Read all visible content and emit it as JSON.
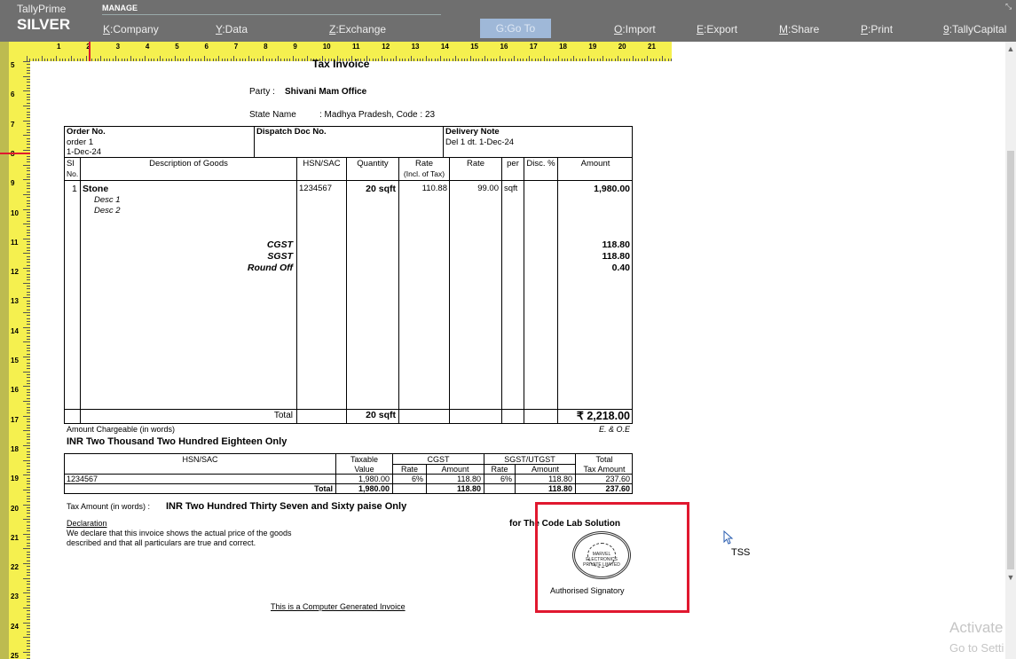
{
  "topbar": {
    "brand_top": "TallyPrime",
    "brand_edition": "SILVER",
    "manage_label": "MANAGE",
    "menu": [
      {
        "key": "K",
        "label": ":Company"
      },
      {
        "key": "Y",
        "label": ":Data"
      },
      {
        "key": "Z",
        "label": ":Exchange"
      },
      {
        "key": "G",
        "label": ":Go To"
      },
      {
        "key": "O",
        "label": ":Import"
      },
      {
        "key": "E",
        "label": ":Export"
      },
      {
        "key": "M",
        "label": ":Share"
      },
      {
        "key": "P",
        "label": ":Print"
      },
      {
        "key": "9",
        "label": ":TallyCapital"
      }
    ]
  },
  "ruler": {
    "h_numbers": [
      "1",
      "2",
      "3",
      "4",
      "5",
      "6",
      "7",
      "8",
      "9",
      "10",
      "11",
      "12",
      "13",
      "14",
      "15",
      "16",
      "17",
      "18",
      "19",
      "20",
      "21"
    ],
    "v_numbers": [
      "5",
      "6",
      "7",
      "8",
      "9",
      "10",
      "11",
      "12",
      "13",
      "14",
      "15",
      "16",
      "17",
      "18",
      "19",
      "20",
      "21",
      "22",
      "23",
      "24",
      "25"
    ]
  },
  "invoice": {
    "title": "Tax Invoice",
    "party_label": "Party :",
    "party_name": "Shivani Mam Office",
    "state_label": "State Name",
    "state_value": ": Madhya Pradesh, Code : 23",
    "order_no_label": "Order No.",
    "order_no": "order 1",
    "order_date": "1-Dec-24",
    "dispatch_label": "Dispatch Doc No.",
    "delivery_label": "Delivery Note",
    "delivery_value": "Del 1 dt. 1-Dec-24",
    "col_sl": "Sl",
    "col_no": "No.",
    "col_desc": "Description of Goods",
    "col_hsn": "HSN/SAC",
    "col_qty": "Quantity",
    "col_rate_incl": "Rate",
    "col_rate_incl2": "(Incl. of Tax)",
    "col_rate": "Rate",
    "col_per": "per",
    "col_disc": "Disc. %",
    "col_amount": "Amount",
    "item_sl": "1",
    "item_name": "Stone",
    "item_desc1": "Desc 1",
    "item_desc2": "Desc 2",
    "item_hsn": "1234567",
    "item_qty": "20 sqft",
    "item_rate_incl": "110.88",
    "item_rate": "99.00",
    "item_per": "sqft",
    "item_amount": "1,980.00",
    "cgst_label": "CGST",
    "sgst_label": "SGST",
    "roundoff_label": "Round Off",
    "cgst_amount": "118.80",
    "sgst_amount": "118.80",
    "roundoff_amount": "0.40",
    "total_label": "Total",
    "total_qty": "20 sqft",
    "total_amount": "₹ 2,218.00",
    "amount_words_label": "Amount Chargeable (in words)",
    "eoe": "E. & O.E",
    "amount_words": "INR Two Thousand Two Hundred Eighteen Only",
    "tax": {
      "h_hsn": "HSN/SAC",
      "h_taxable": "Taxable",
      "h_value": "Value",
      "h_cgst": "CGST",
      "h_sgst": "SGST/UTGST",
      "h_total": "Total",
      "h_rate": "Rate",
      "h_amount": "Amount",
      "h_tax_amount": "Tax Amount",
      "row_hsn": "1234567",
      "row_taxable": "1,980.00",
      "row_cgst_rate": "6%",
      "row_cgst_amt": "118.80",
      "row_sgst_rate": "6%",
      "row_sgst_amt": "118.80",
      "row_total": "237.60",
      "total_label": "Total",
      "total_taxable": "1,980.00",
      "total_cgst": "118.80",
      "total_sgst": "118.80",
      "total_total": "237.60"
    },
    "tax_words_label": "Tax Amount (in words) :",
    "tax_words": "INR Two Hundred Thirty Seven and Sixty paise Only",
    "declaration_title": "Declaration",
    "declaration_line1": "We declare that this invoice shows the actual price of the goods",
    "declaration_line2": "described and that all particulars are true and correct.",
    "for_company": "for The Code Lab Solution",
    "stamp_text": "MARVEL ELECTRONICS PRIVATE LIMITED",
    "signatory": "Authorised Signatory",
    "footer": "This is a Computer Generated Invoice"
  },
  "overlay": {
    "tss": "TSS",
    "activate_title": "Activate",
    "activate_sub": "Go to Setti"
  },
  "colors": {
    "topbar": "#6f6f6f",
    "ruler": "#f5f04f",
    "highlight": "#e0182f"
  }
}
